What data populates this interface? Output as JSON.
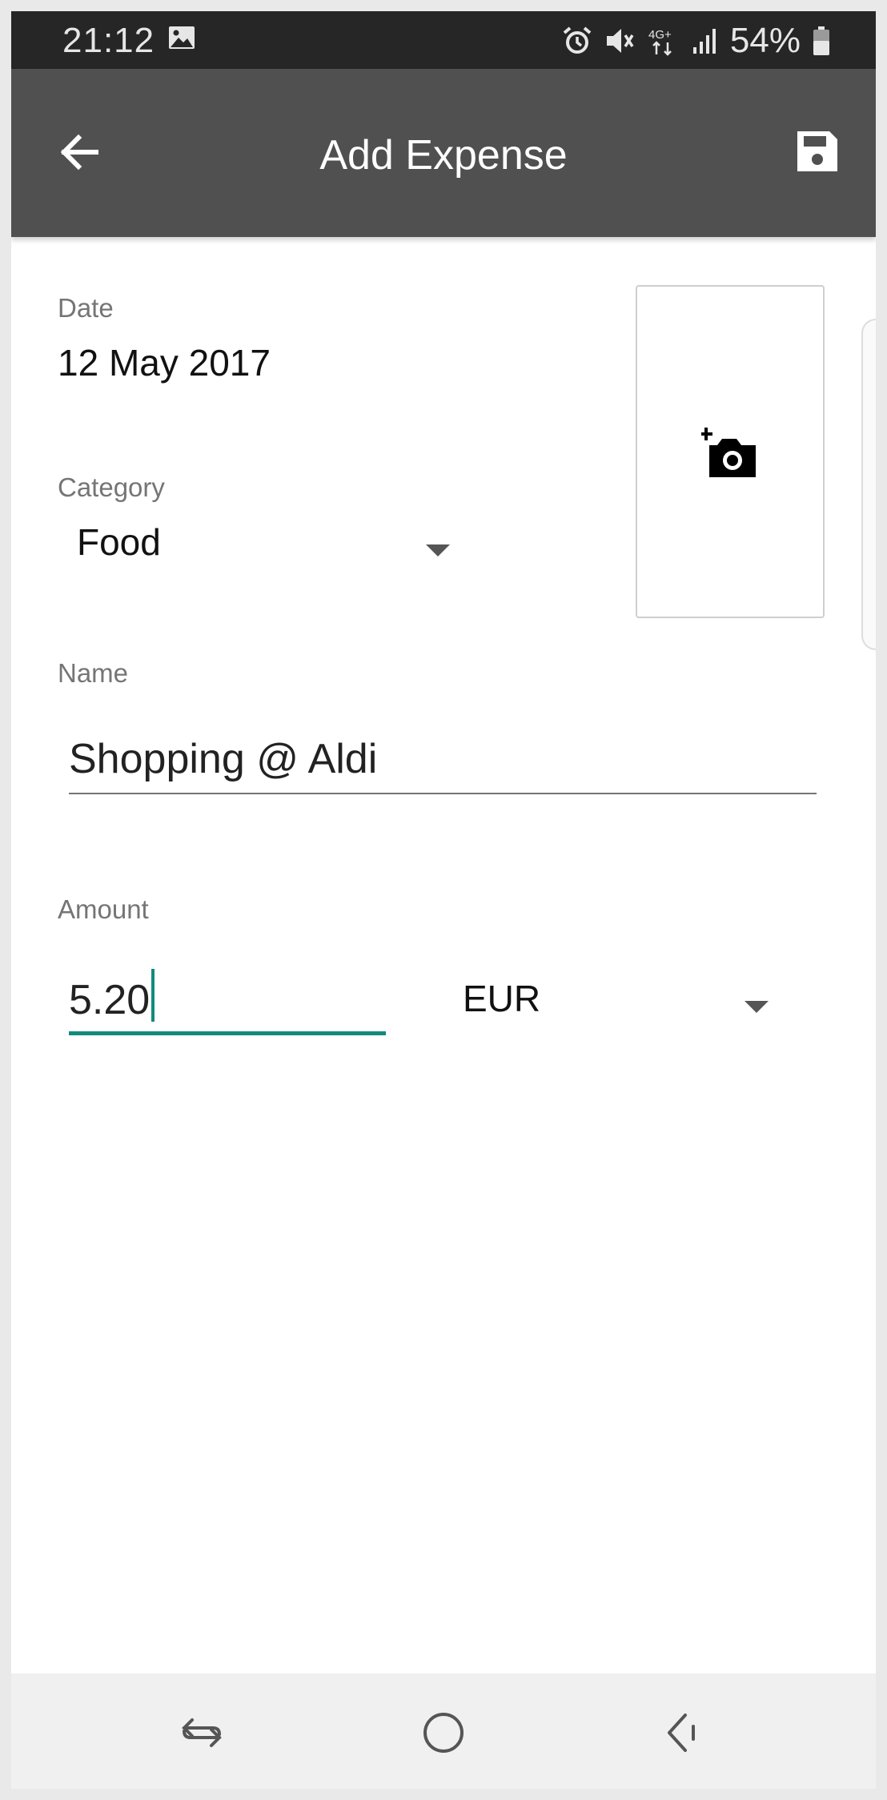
{
  "status_bar": {
    "time": "21:12",
    "battery": "54%",
    "network": "4G+",
    "icons": [
      "gallery-icon",
      "alarm-icon",
      "mute-icon",
      "network-4g-icon",
      "signal-icon",
      "battery-icon"
    ]
  },
  "app_bar": {
    "title": "Add Expense",
    "back_icon": "arrow-left-icon",
    "save_icon": "floppy-disk-icon"
  },
  "form": {
    "date": {
      "label": "Date",
      "value": "12 May 2017"
    },
    "category": {
      "label": "Category",
      "value": "Food"
    },
    "photo": {
      "icon": "add-a-photo-icon"
    },
    "name": {
      "label": "Name",
      "value": "Shopping @ Aldi"
    },
    "amount": {
      "label": "Amount",
      "value": "5.20",
      "currency": "EUR"
    }
  },
  "nav_bar": {
    "icons": [
      "recents-icon",
      "home-icon",
      "back-icon"
    ]
  },
  "colors": {
    "status_bar": "#262626",
    "app_bar": "#505050",
    "accent": "#138a7e",
    "nav_bar": "#f0f0f0"
  }
}
